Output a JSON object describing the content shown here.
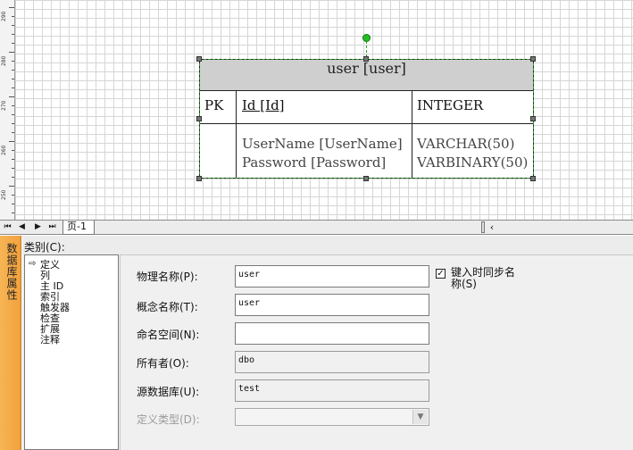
{
  "ruler": {
    "labels": [
      "290",
      "280",
      "270",
      "260",
      "250"
    ]
  },
  "entity": {
    "title": "user [user]",
    "pk_key": "PK",
    "pk_field": "Id [Id]",
    "pk_type": "INTEGER",
    "fields": [
      {
        "name": "UserName [UserName]",
        "type": "VARCHAR(50)"
      },
      {
        "name": "Password [Password]",
        "type": "VARBINARY(50)"
      }
    ]
  },
  "page_tabs": {
    "current": "页-1"
  },
  "side_panel": {
    "title": "数据库属性"
  },
  "category": {
    "label": "类别(C):",
    "items": [
      "定义",
      "列",
      "主 ID",
      "索引",
      "触发器",
      "检查",
      "扩展",
      "注释"
    ],
    "selected": "定义"
  },
  "form": {
    "physical_name_label": "物理名称(P):",
    "physical_name_value": "user",
    "conceptual_name_label": "概念名称(T):",
    "conceptual_name_value": "user",
    "namespace_label": "命名空间(N):",
    "namespace_value": "",
    "owner_label": "所有者(O):",
    "owner_value": "dbo",
    "source_db_label": "源数据库(U):",
    "source_db_value": "test",
    "def_type_label": "定义类型(D):",
    "def_type_value": "",
    "sync_checkbox_label": "键入时同步名称(S)",
    "sync_checked": true
  }
}
